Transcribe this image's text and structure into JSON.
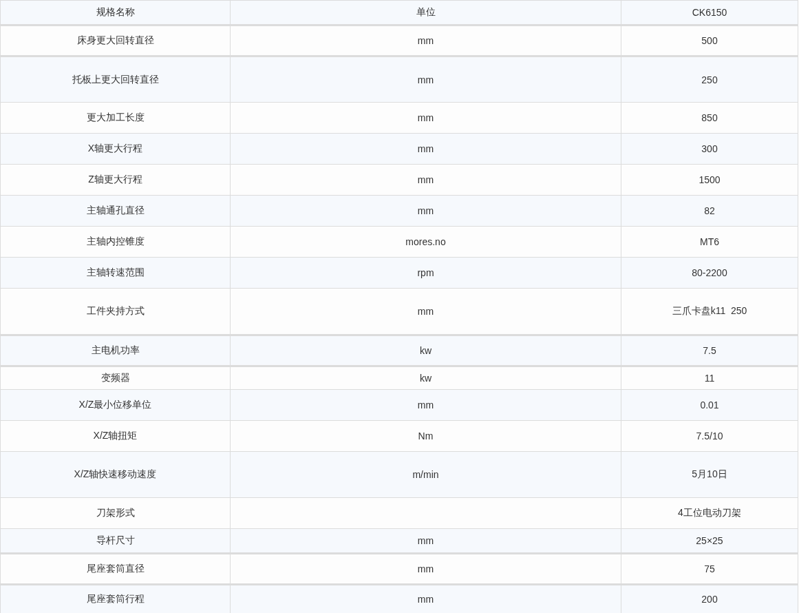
{
  "table": {
    "columns": [
      "规格名称",
      "单位",
      "CK6150"
    ],
    "rows": [
      {
        "name": "床身更大回转直径",
        "unit": "mm",
        "value": "500"
      },
      {
        "name": "托板上更大回转直径",
        "unit": "mm",
        "value": "250"
      },
      {
        "name": "更大加工长度",
        "unit": "mm",
        "value": "850"
      },
      {
        "name": "X轴更大行程",
        "unit": "mm",
        "value": "300"
      },
      {
        "name": "Z轴更大行程",
        "unit": "mm",
        "value": "1500"
      },
      {
        "name": "主轴通孔直径",
        "unit": "mm",
        "value": "82"
      },
      {
        "name": "主轴内控锥度",
        "unit": "mores.no",
        "value": "MT6"
      },
      {
        "name": "主轴转速范围",
        "unit": "rpm",
        "value": "80-2200"
      },
      {
        "name": "工件夹持方式",
        "unit": "mm",
        "value": "三爪卡盘k11  250"
      },
      {
        "name": "主电机功率",
        "unit": "kw",
        "value": "7.5"
      },
      {
        "name": "变频器",
        "unit": "kw",
        "value": "11"
      },
      {
        "name": "X/Z最小位移单位",
        "unit": "mm",
        "value": "0.01"
      },
      {
        "name": "X/Z轴扭矩",
        "unit": "Nm",
        "value": "7.5/10"
      },
      {
        "name": "X/Z轴快速移动速度",
        "unit": "m/min",
        "value": "5月10日"
      },
      {
        "name": "刀架形式",
        "value": "4工位电动刀架"
      },
      {
        "name": "导杆尺寸",
        "unit": "mm",
        "value": "25×25"
      },
      {
        "name": "尾座套筒直径",
        "unit": "mm",
        "value": "75"
      },
      {
        "name": "尾座套筒行程",
        "unit": "mm",
        "value": "200"
      }
    ]
  }
}
